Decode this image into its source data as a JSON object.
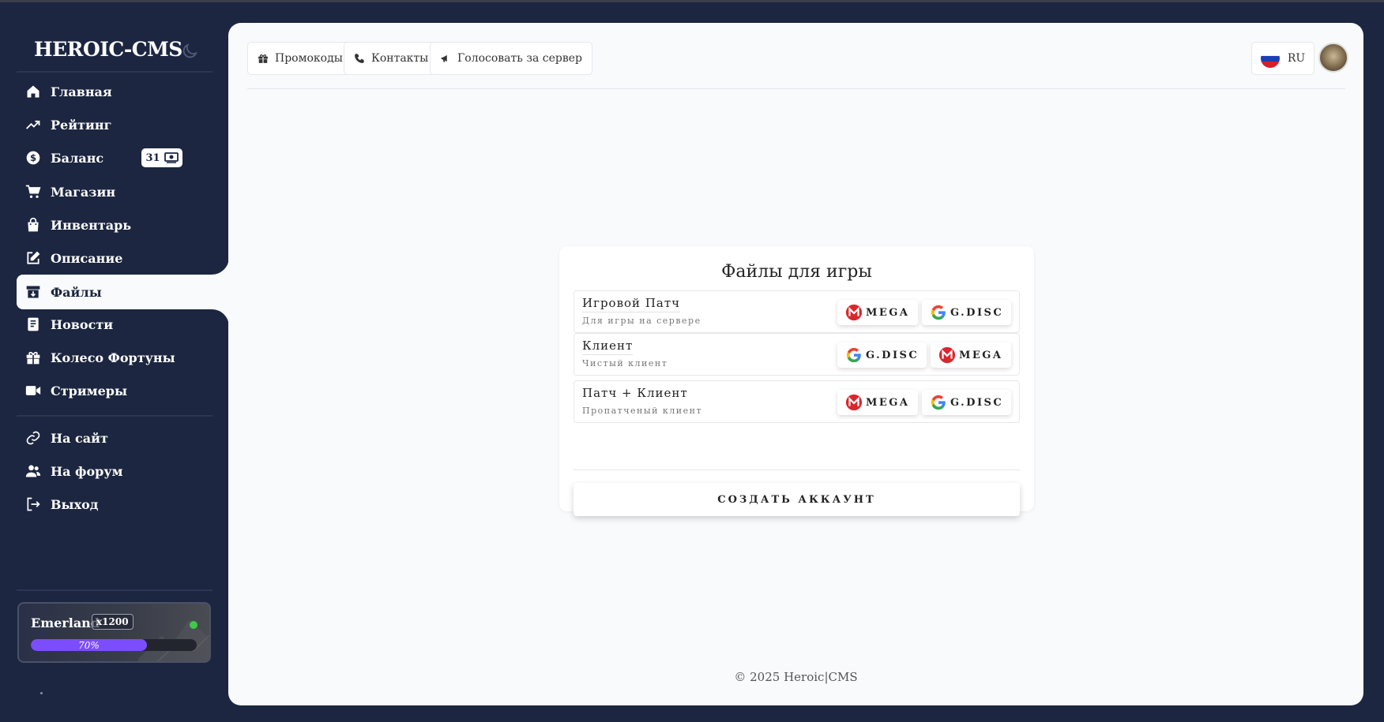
{
  "brand": "HEROIC-CMS",
  "nav": {
    "items": [
      {
        "label": "Главная",
        "icon": "home-icon"
      },
      {
        "label": "Рейтинг",
        "icon": "trending-up-icon"
      },
      {
        "label": "Баланс",
        "icon": "dollar-circle-icon"
      },
      {
        "label": "Магазин",
        "icon": "cart-icon"
      },
      {
        "label": "Инвентарь",
        "icon": "shopping-bag-icon"
      },
      {
        "label": "Описание",
        "icon": "edit-icon"
      },
      {
        "label": "Файлы",
        "icon": "archive-download-icon"
      },
      {
        "label": "Новости",
        "icon": "news-icon"
      },
      {
        "label": "Колесо Фортуны",
        "icon": "gift-icon"
      },
      {
        "label": "Стримеры",
        "icon": "video-icon"
      }
    ],
    "links": [
      {
        "label": "На сайт",
        "icon": "link-icon"
      },
      {
        "label": "На форум",
        "icon": "users-icon"
      },
      {
        "label": "Выход",
        "icon": "logout-icon"
      }
    ],
    "active": "Файлы",
    "balance_badge": "31"
  },
  "server": {
    "name": "Emerland",
    "rate": "x1200",
    "progress_label": "70%",
    "progress": 0.7,
    "status_color": "#3ec94a"
  },
  "topbar": {
    "promo": "Промокоды",
    "contacts": "Контакты",
    "vote": "Голосовать за сервер",
    "lang": "RU"
  },
  "files": {
    "title": "Файлы для игры",
    "rows": [
      {
        "name": "Игровой Патч",
        "desc": "Для игры на сервере",
        "buttons": [
          "MEGA",
          "G.DISC"
        ]
      },
      {
        "name": "Клиент",
        "desc": "Чистый клиент",
        "buttons": [
          "G.DISC",
          "MEGA"
        ]
      },
      {
        "name": "Патч + Клиент",
        "desc": "Пропатченый клиент",
        "buttons": [
          "MEGA",
          "G.DISC"
        ]
      }
    ],
    "create_account": "СОЗДАТЬ АККАУНТ"
  },
  "footer": "© 2025 Heroic|CMS",
  "colors": {
    "sidebar_bg": "#1c2640",
    "main_bg": "#f8fafc",
    "progress": "#7c4dff",
    "mega": "#d9272e"
  }
}
